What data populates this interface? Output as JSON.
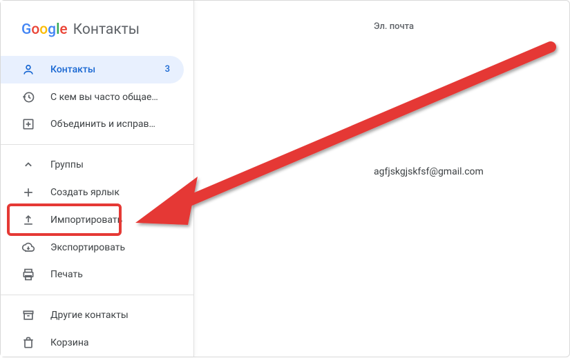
{
  "brand": {
    "logo": "Google",
    "app_name": "Контакты"
  },
  "sidebar": {
    "contacts": {
      "label": "Контакты",
      "count": "3"
    },
    "frequent": {
      "label": "С кем вы часто общае…"
    },
    "merge_fix": {
      "label": "Объединить и исправ…"
    },
    "groups": {
      "label": "Группы"
    },
    "create_label": {
      "label": "Создать ярлык"
    },
    "import": {
      "label": "Импортировать"
    },
    "export": {
      "label": "Экспортировать"
    },
    "print": {
      "label": "Печать"
    },
    "other_contacts": {
      "label": "Другие контакты"
    },
    "trash": {
      "label": "Корзина"
    }
  },
  "main": {
    "email_header": "Эл. почта",
    "email_value": "agfjskgjskfsf@gmail.com"
  },
  "colors": {
    "highlight": "#e53935",
    "active_bg": "#e8f0fe",
    "active_fg": "#1967d2"
  }
}
